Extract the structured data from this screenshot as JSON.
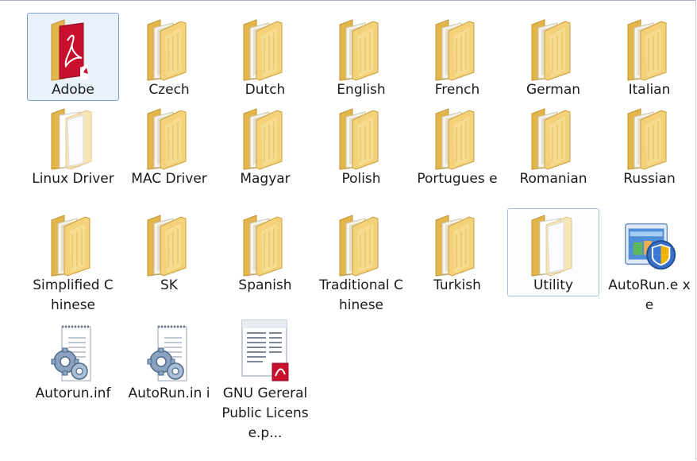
{
  "items": [
    {
      "label": "Adobe",
      "type": "folder-pdf",
      "selected": true
    },
    {
      "label": "Czech",
      "type": "folder"
    },
    {
      "label": "Dutch",
      "type": "folder"
    },
    {
      "label": "English",
      "type": "folder"
    },
    {
      "label": "French",
      "type": "folder"
    },
    {
      "label": "German",
      "type": "folder"
    },
    {
      "label": "Italian",
      "type": "folder"
    },
    {
      "label": "Linux Driver",
      "type": "folder-empty"
    },
    {
      "label": "MAC Driver",
      "type": "folder"
    },
    {
      "label": "Magyar",
      "type": "folder"
    },
    {
      "label": "Polish",
      "type": "folder"
    },
    {
      "label": "Portugues e",
      "type": "folder"
    },
    {
      "label": "Romanian",
      "type": "folder"
    },
    {
      "label": "Russian",
      "type": "folder"
    },
    {
      "label": "Simplified Chinese",
      "type": "folder"
    },
    {
      "label": "SK",
      "type": "folder"
    },
    {
      "label": "Spanish",
      "type": "folder"
    },
    {
      "label": "Traditional Chinese",
      "type": "folder"
    },
    {
      "label": "Turkish",
      "type": "folder"
    },
    {
      "label": "Utility",
      "type": "folder-empty",
      "hovered": true
    },
    {
      "label": "AutoRun.e xe",
      "type": "installer-exe"
    },
    {
      "label": "Autorun.inf",
      "type": "config-file"
    },
    {
      "label": "AutoRun.in i",
      "type": "config-file"
    },
    {
      "label": "GNU Gereral Public License.p...",
      "type": "pdf-document"
    }
  ],
  "colors": {
    "selection_border": "#7da2ce",
    "selection_fill": "#e9f1fb",
    "folder_yellow": "#f3d27a",
    "pdf_red": "#c8102e"
  }
}
